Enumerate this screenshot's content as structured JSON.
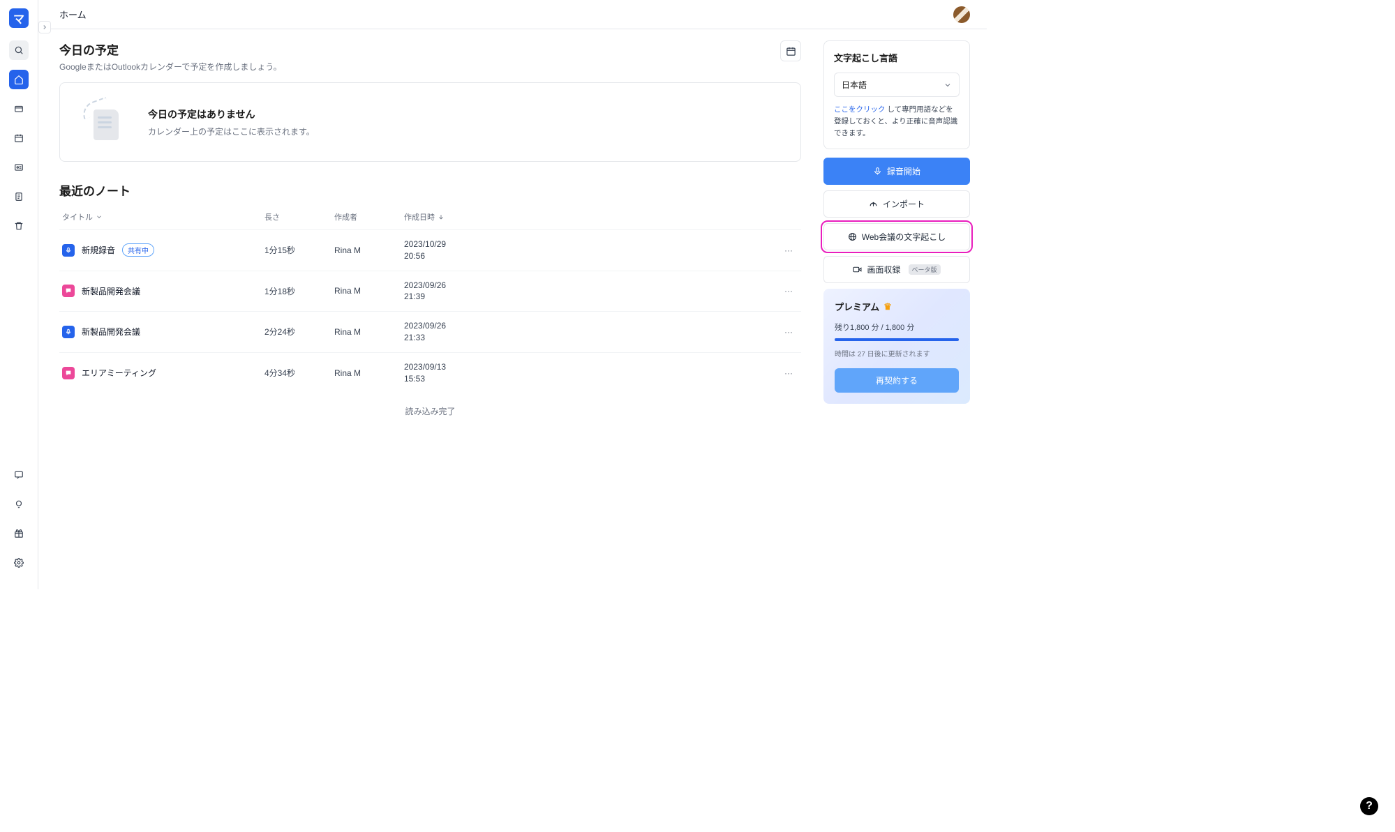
{
  "app": {
    "logo_letter": "マ"
  },
  "header": {
    "title": "ホーム"
  },
  "today": {
    "title": "今日の予定",
    "subtitle": "GoogleまたはOutlookカレンダーで予定を作成しましょう。",
    "empty_title": "今日の予定はありません",
    "empty_sub": "カレンダー上の予定はここに表示されます。"
  },
  "notes": {
    "section_title": "最近のノート",
    "columns": {
      "title": "タイトル",
      "length": "長さ",
      "author": "作成者",
      "date": "作成日時"
    },
    "rows": [
      {
        "icon": "mic",
        "title": "新規録音",
        "badge": "共有中",
        "length": "1分15秒",
        "author": "Rina M",
        "date": "2023/10/29 20:56"
      },
      {
        "icon": "chat",
        "title": "新製品開発会議",
        "length": "1分18秒",
        "author": "Rina M",
        "date": "2023/09/26 21:39"
      },
      {
        "icon": "mic",
        "title": "新製品開発会議",
        "length": "2分24秒",
        "author": "Rina M",
        "date": "2023/09/26 21:33"
      },
      {
        "icon": "chat",
        "title": "エリアミーティング",
        "length": "4分34秒",
        "author": "Rina M",
        "date": "2023/09/13 15:53"
      }
    ],
    "load_done": "読み込み完了"
  },
  "lang_panel": {
    "title": "文字起こし言語",
    "selected": "日本語",
    "hint_link": "ここをクリック",
    "hint_rest": " して専門用語などを登録しておくと、より正確に音声認識できます。"
  },
  "actions": {
    "record": "録音開始",
    "import": "インポート",
    "web_meeting": "Web会議の文字起こし",
    "screen_rec": "画面収録",
    "beta": "ベータ版"
  },
  "premium": {
    "title": "プレミアム",
    "line_prefix": "残り",
    "minutes_left": "1,800 分",
    "separator": " / ",
    "minutes_total": "1,800 分",
    "note": "時間は 27 日後に更新されます",
    "button": "再契約する"
  },
  "help": "?"
}
